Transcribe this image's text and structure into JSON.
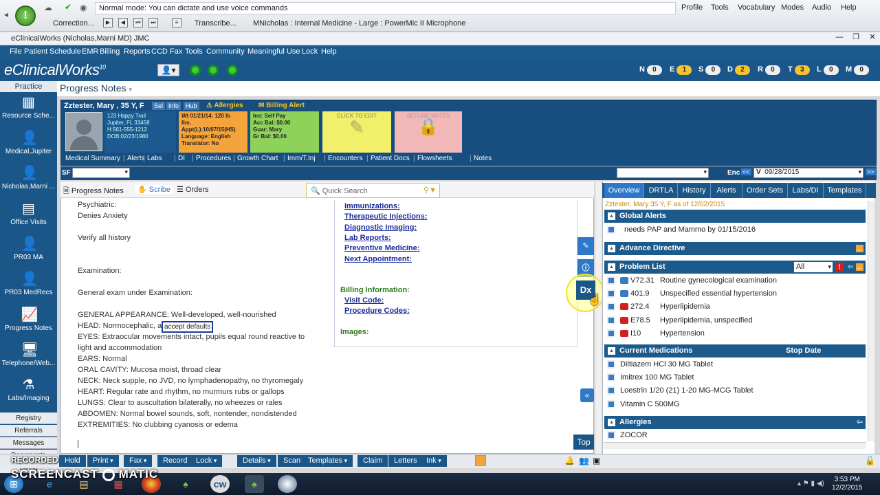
{
  "dragon": {
    "mode_text": "Normal mode: You can dictate and use voice commands",
    "menus": [
      "Profile",
      "Tools",
      "Vocabulary",
      "Modes",
      "Audio",
      "Help"
    ],
    "correction": "Correction...",
    "transcribe": "Transcribe...",
    "mic_label": "MNicholas : Internal Medicine - Large : PowerMic II Microphone"
  },
  "window": {
    "title": "eClinicalWorks (Nicholas,Marni MD)  JMC"
  },
  "menubar": [
    "File",
    "Patient",
    "Schedule",
    "EMR",
    "Billing",
    "Reports",
    "CCD",
    "Fax",
    "Tools",
    "Community",
    "Meaningful Use",
    "Lock",
    "Help"
  ],
  "brand": {
    "name": "eClinicalWorks",
    "version": "10"
  },
  "badges": [
    {
      "letter": "N",
      "count": "0",
      "color": "#eeeeee"
    },
    {
      "letter": "E",
      "count": "1",
      "color": "#f4c430"
    },
    {
      "letter": "S",
      "count": "0",
      "color": "#eeeeee"
    },
    {
      "letter": "D",
      "count": "2",
      "color": "#f4c430"
    },
    {
      "letter": "R",
      "count": "0",
      "color": "#eeeeee"
    },
    {
      "letter": "T",
      "count": "3",
      "color": "#f4c430"
    },
    {
      "letter": "L",
      "count": "0",
      "color": "#eeeeee"
    },
    {
      "letter": "M",
      "count": "0",
      "color": "#eeeeee"
    }
  ],
  "leftnav": {
    "practice": "Practice",
    "items": [
      "Resource Sche...",
      "Medical,Jupiter",
      "Nicholas,Marni ...",
      "Office Visits",
      "PR03 MA",
      "PR03 MedRecs",
      "Progress Notes",
      "Telephone/Web...",
      "Labs/Imaging"
    ],
    "bottom": [
      "Registry",
      "Referrals",
      "Messages",
      "Documents",
      "Billing"
    ]
  },
  "page_title": "Progress Notes",
  "patient": {
    "name": "Zztester, Mary , 35 Y, F",
    "tags": [
      "Sel",
      "Info",
      "Hub"
    ],
    "allergies": "Allergies",
    "billing_alert": "Billing Alert",
    "address": [
      "123 Happy Trail",
      "Jupiter, FL 33458",
      "H:561-555-1212",
      "DOB:02/23/1980"
    ],
    "visit": [
      "Wt 01/21/14: 120 lb",
      "lbs.",
      "Appt(L):10/07/15(HS)",
      "Language: English",
      "Translator: No"
    ],
    "ins": [
      "Ins:      Self Pay",
      "Acc Bal: $0.00",
      "Guar:     Mary",
      "Gr Bal:   $0.00"
    ],
    "click_to_edit": "CLICK TO EDIT",
    "secure_notes": "SECURE NOTES"
  },
  "links": [
    "Medical Summary",
    "Alerts",
    "Labs",
    "DI",
    "Procedures",
    "Growth Chart",
    "Imm/T.Inj",
    "Encounters",
    "Patient Docs",
    "Flowsheets",
    "Notes"
  ],
  "sf_label": "SF",
  "enc": {
    "label": "Enc",
    "version": "V",
    "date": "09/28/2015"
  },
  "doc_tabs": [
    "Progress Notes",
    "Scribe",
    "Orders"
  ],
  "quick_search": "Quick Search",
  "note_lines": [
    "Psychiatric:",
    "Denies Anxiety",
    "",
    "Verify all history",
    "",
    "",
    "Examination:",
    "",
    "General exam under Examination:",
    "",
    "GENERAL APPEARANCE: Well-developed, well-nourished",
    "HEAD: Normocephalic, a",
    "EYES: Extraocular movements intact, pupils equal round reactive to",
    "light and accommodation",
    "EARS: Normal",
    "ORAL CAVITY: Mucosa moist, throad clear",
    "NECK: Neck supple, no JVD, no lymphadenopathy, no thyromegaly",
    "HEART: Regular rate and rhythm, no murmurs rubs or gallops",
    "LUNGS: Clear to auscultation bilaterally, no wheezes or rales",
    "ABDOMEN: Normal bowel sounds, soft, nontender, nondistended",
    "EXTREMITIES: No clubbing cyanosis or edema"
  ],
  "accept_defaults": "accept defaults",
  "right_links": [
    "Immunizations:",
    "Therapeutic Injections:",
    "Diagnostic Imaging:",
    "Lab Reports:",
    "Preventive Medicine:",
    "Next Appointment:"
  ],
  "billing_info": "Billing Information:",
  "billing_links": [
    "Visit Code:",
    "Procedure Codes:"
  ],
  "images_label": "Images:",
  "top_btn": "Top",
  "dx_label": "Dx",
  "rtabs": [
    "Overview",
    "DRTLA",
    "History",
    "Alerts",
    "Order Sets",
    "Labs/DI",
    "Templates"
  ],
  "as_of": "Zztester, Mary 35 Y, F as of 12/02/2015",
  "global_alerts": {
    "title": "Global Alerts",
    "items": [
      "needs PAP and Mammo by 01/15/2016"
    ]
  },
  "advance_directive": "Advance Directive",
  "problem_list": {
    "title": "Problem List",
    "filter": "All",
    "items": [
      {
        "code": "V72.31",
        "desc": "Routine gynecological examination",
        "flag": "#3a7bc0"
      },
      {
        "code": "401.9",
        "desc": "Unspecified essential hypertension",
        "flag": "#3a7bc0"
      },
      {
        "code": "272.4",
        "desc": "Hyperlipidemia",
        "flag": "#d02020"
      },
      {
        "code": "E78.5",
        "desc": "Hyperlipidemia, unspecified",
        "flag": "#d02020"
      },
      {
        "code": "I10",
        "desc": "Hypertension",
        "flag": "#d02020"
      }
    ]
  },
  "current_meds": {
    "title": "Current Medications",
    "stop_date": "Stop Date",
    "items": [
      "Diltiazem HCl 30 MG Tablet",
      "Imitrex 100 MG Tablet",
      "Loestrin 1/20 (21) 1-20 MG-MCG Tablet",
      "Vitamin C 500MG"
    ]
  },
  "allergies_panel": {
    "title": "Allergies",
    "items": [
      "ZOCOR"
    ]
  },
  "bottom_buttons": [
    {
      "label": "Hold",
      "dd": false
    },
    {
      "label": "Print",
      "dd": true
    },
    {
      "label": "Fax",
      "dd": true
    },
    {
      "label": "Record",
      "dd": false
    },
    {
      "label": "Lock",
      "dd": true
    },
    {
      "label": "Details",
      "dd": true
    },
    {
      "label": "Scan",
      "dd": false
    },
    {
      "label": "Templates",
      "dd": true
    },
    {
      "label": "Claim",
      "dd": false
    },
    {
      "label": "Letters",
      "dd": false
    },
    {
      "label": "Ink",
      "dd": true
    }
  ],
  "watermark": {
    "line1": "RECORDED WITH",
    "line2": "SCREENCAST",
    "line3": "MATIC"
  },
  "clock": {
    "time": "3:53 PM",
    "date": "12/2/2015"
  }
}
